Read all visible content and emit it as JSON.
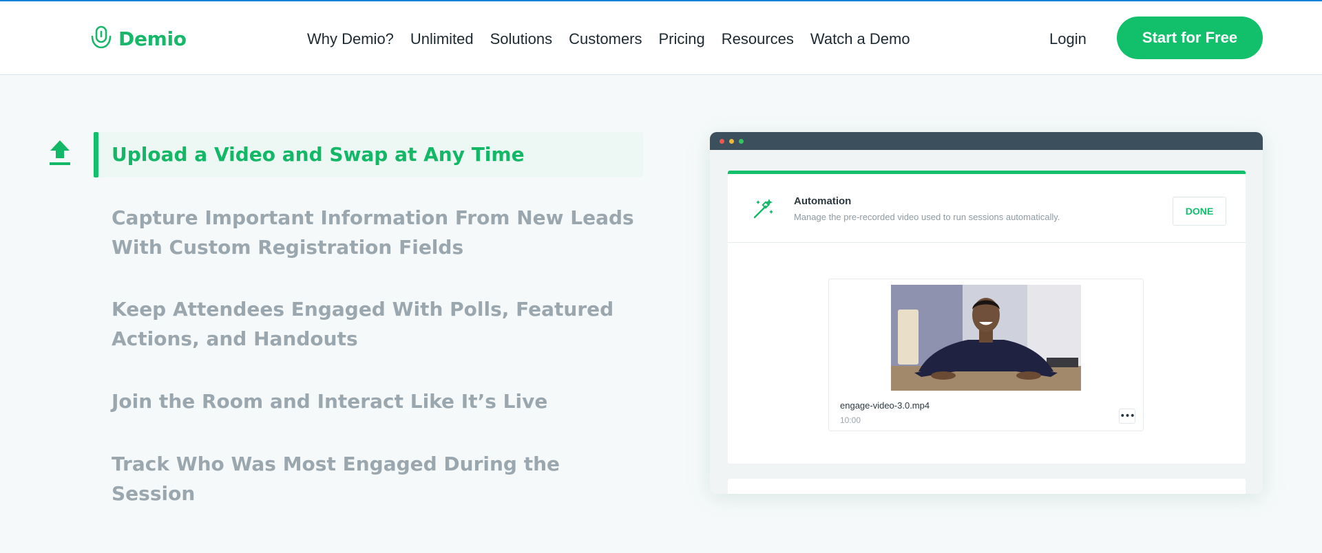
{
  "header": {
    "logo_text": "Demio",
    "nav": [
      "Why Demio?",
      "Unlimited",
      "Solutions",
      "Customers",
      "Pricing",
      "Resources",
      "Watch a Demo"
    ],
    "login_label": "Login",
    "cta_label": "Start for Free"
  },
  "features": {
    "active": "Upload a Video and Swap at Any Time",
    "items": [
      "Capture Important Information From New Leads With Custom Registration Fields",
      "Keep Attendees Engaged With Polls, Featured Actions, and Handouts",
      "Join the Room and Interact Like It’s Live",
      "Track Who Was Most Engaged During the Session"
    ]
  },
  "mock": {
    "title": "Automation",
    "description": "Manage the pre-recorded video used to run sessions automatically.",
    "done_label": "DONE",
    "video_name": "engage-video-3.0.mp4",
    "video_duration": "10:00",
    "more_label": "•••"
  },
  "colors": {
    "brand_green": "#12c06c",
    "muted_text": "#9ba7ae",
    "top_accent": "#1a7fd6"
  },
  "icons": {
    "logo": "microphone-icon",
    "feature": "upload-icon",
    "automation": "magic-wand-icon",
    "options": "more-options-icon"
  }
}
